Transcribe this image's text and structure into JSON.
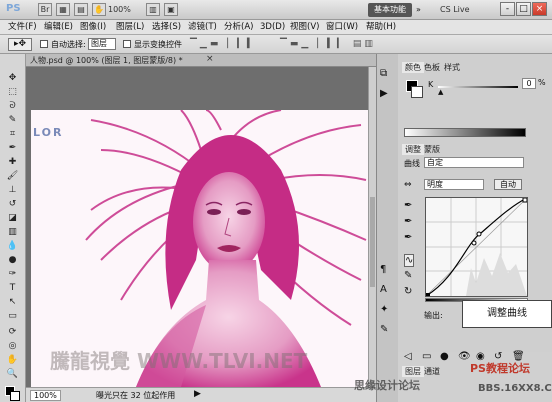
{
  "titlebar": {
    "logo": "PS",
    "zoom": "100%",
    "workspace": "基本功能",
    "cslive": "CS Live",
    "minimize": "-",
    "maximize": "□",
    "close": "×"
  },
  "menu": [
    "文件(F)",
    "编辑(E)",
    "图像(I)",
    "图层(L)",
    "选择(S)",
    "滤镜(T)",
    "分析(A)",
    "3D(D)",
    "视图(V)",
    "窗口(W)",
    "帮助(H)"
  ],
  "options": {
    "auto_select_label": "自动选择:",
    "auto_select_value": "图层",
    "show_transform_label": "显示变换控件"
  },
  "document": {
    "tab_title": "人物.psd @ 100% (图层 1, 图层蒙版/8) *",
    "zoom": "100%",
    "status": "曝光只在 32 位起作用",
    "logo_text": "LOR"
  },
  "color_panel": {
    "tabs": [
      "颜色",
      "色板",
      "样式"
    ],
    "k_label": "K",
    "k_value": "0",
    "k_unit": "%"
  },
  "adjust_panel": {
    "tabs": [
      "调整",
      "蒙版"
    ],
    "preset_label": "曲线",
    "preset_value": "自定",
    "channel_value": "明度",
    "auto_button": "自动",
    "output_label": "输出:",
    "tooltip": "调整曲线"
  },
  "bottom_panels": {
    "tabs": [
      "图层",
      "通道"
    ]
  },
  "watermarks": {
    "site1": "騰龍視覺 WWW.TLVI.NET",
    "site2": "PS教程论坛",
    "site3": "BBS.16XX8.COM",
    "site4": "思缘设计论坛"
  }
}
